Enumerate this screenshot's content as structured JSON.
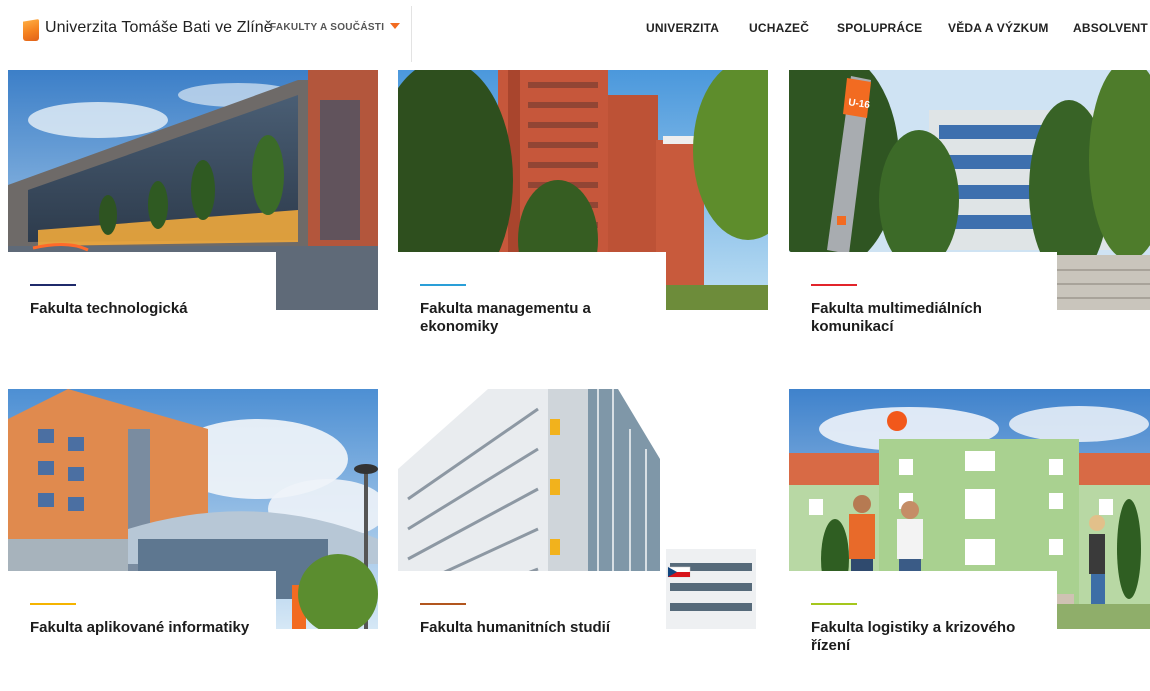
{
  "header": {
    "brand": "Univerzita Tomáše Bati ve Zlíně",
    "faculties_menu": "FAKULTY A SOUČÁSTI",
    "nav": [
      "UNIVERZITA",
      "UCHAZEČ",
      "SPOLUPRÁCE",
      "VĚDA A VÝZKUM",
      "ABSOLVENT"
    ]
  },
  "faculties": [
    {
      "title": "Fakulta technologická",
      "accent": "#1f2a6b"
    },
    {
      "title": "Fakulta managementu a ekonomiky",
      "accent": "#2a9fd8"
    },
    {
      "title": "Fakulta multimediálních komunikací",
      "accent": "#e2242b"
    },
    {
      "title": "Fakulta aplikované informatiky",
      "accent": "#f5b400"
    },
    {
      "title": "Fakulta humanitních studií",
      "accent": "#b2561e"
    },
    {
      "title": "Fakulta logistiky a krizového řízení",
      "accent": "#a5c71d"
    }
  ],
  "colors": {
    "brand_orange": "#f26b21"
  },
  "photo_signs": {
    "post_label": "U-16"
  }
}
